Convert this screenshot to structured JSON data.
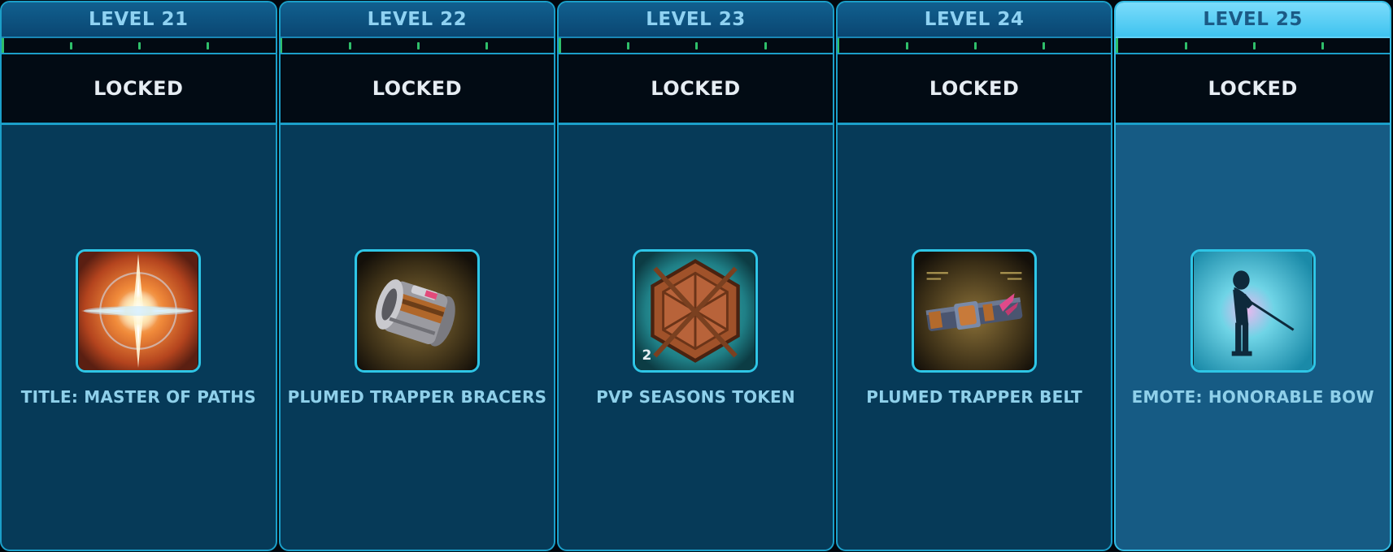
{
  "levels": [
    {
      "label": "LEVEL 21",
      "status": "LOCKED",
      "reward": "TITLE: MASTER OF PATHS",
      "icon": "starburst-icon",
      "progress": 0.0
    },
    {
      "label": "LEVEL 22",
      "status": "LOCKED",
      "reward": "PLUMED TRAPPER BRACERS",
      "icon": "bracers-icon",
      "progress": 0.0
    },
    {
      "label": "LEVEL 23",
      "status": "LOCKED",
      "reward": "PVP SEASONS TOKEN",
      "icon": "hexagon-token-icon",
      "quantity": "2",
      "progress": 0.0
    },
    {
      "label": "LEVEL 24",
      "status": "LOCKED",
      "reward": "PLUMED TRAPPER BELT",
      "icon": "belt-icon",
      "progress": 0.0
    },
    {
      "label": "LEVEL 25",
      "status": "LOCKED",
      "reward": "EMOTE: HONORABLE BOW",
      "icon": "bowing-figure-icon",
      "progress": 0.0,
      "highlighted": true
    }
  ],
  "colors": {
    "panel": "#063a58",
    "panel_highlight": "#165b84",
    "border": "#1b9fc9",
    "header_highlight": "#62d0f6",
    "progress": "#2fbf6a"
  }
}
